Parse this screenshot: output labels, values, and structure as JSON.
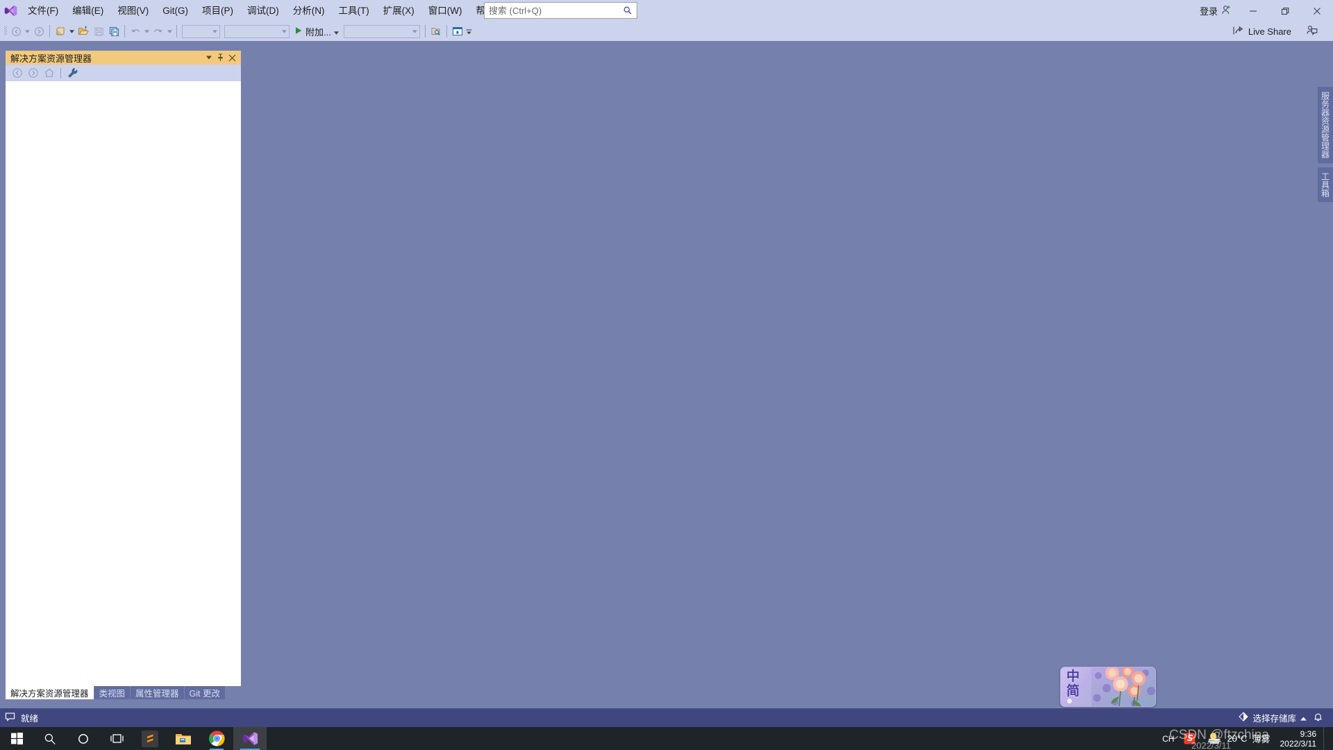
{
  "window": {
    "signin_label": "登录",
    "minimize": "—",
    "restore": "❐",
    "close": "✕"
  },
  "menu": {
    "items": [
      {
        "label": "文件(F)"
      },
      {
        "label": "编辑(E)"
      },
      {
        "label": "视图(V)"
      },
      {
        "label": "Git(G)"
      },
      {
        "label": "项目(P)"
      },
      {
        "label": "调试(D)"
      },
      {
        "label": "分析(N)"
      },
      {
        "label": "工具(T)"
      },
      {
        "label": "扩展(X)"
      },
      {
        "label": "窗口(W)"
      },
      {
        "label": "帮助(H)"
      }
    ]
  },
  "search": {
    "placeholder": "搜索 (Ctrl+Q)",
    "value": ""
  },
  "toolbar": {
    "attach_label": "附加...",
    "config_value": "",
    "platform_value": "",
    "startup_value": "",
    "liveshare_label": "Live Share"
  },
  "solution_explorer": {
    "title": "解决方案资源管理器",
    "tabs": [
      {
        "label": "解决方案资源管理器",
        "active": true
      },
      {
        "label": "类视图",
        "active": false
      },
      {
        "label": "属性管理器",
        "active": false
      },
      {
        "label": "Git 更改",
        "active": false
      }
    ]
  },
  "side_tabs": [
    {
      "label": "服务器资源管理器"
    },
    {
      "label": "工具箱"
    }
  ],
  "statusbar": {
    "ready_text": "就绪",
    "repo_text": "选择存储库"
  },
  "ime": {
    "mode_language": "中",
    "mode_shape": "简"
  },
  "taskbar": {
    "apps": [
      {
        "name": "start",
        "label": "开始"
      },
      {
        "name": "search",
        "label": "搜索"
      },
      {
        "name": "cortana",
        "label": "Cortana"
      },
      {
        "name": "taskview",
        "label": "任务视图"
      },
      {
        "name": "sublime",
        "label": "Sublime Text"
      },
      {
        "name": "explorer",
        "label": "文件资源管理器"
      },
      {
        "name": "chrome",
        "label": "Google Chrome"
      },
      {
        "name": "visualstudio",
        "label": "Visual Studio"
      }
    ],
    "tray": {
      "ime_indicator": "CH",
      "weather_temp": "20°C",
      "weather_desc": "薄雾",
      "time": "9:36",
      "date": "2022/3/11"
    }
  },
  "watermark": {
    "line1": "CSDN @ftzchina",
    "line2": "2022/3/11"
  },
  "colors": {
    "accent_purple": "#68217a",
    "workspace_bg": "#7580ad",
    "chrome_bg": "#ccd3ec",
    "panel_title_active": "#f2c97d",
    "status_bg": "#40467e",
    "taskbar_bg": "#1f2429"
  }
}
